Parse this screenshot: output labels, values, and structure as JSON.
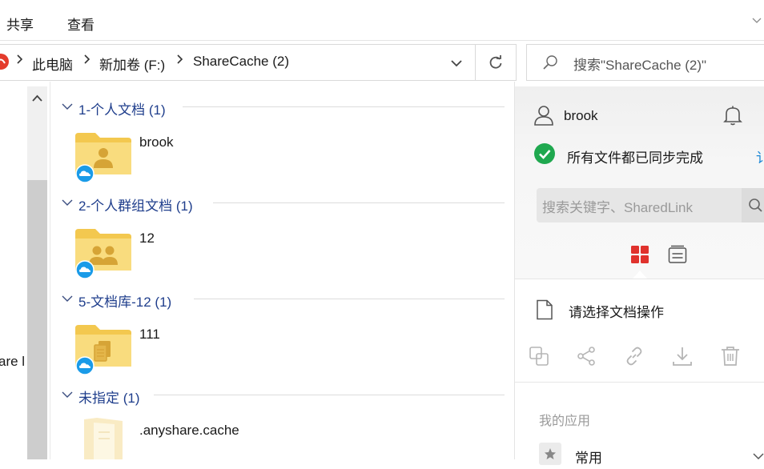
{
  "ribbon": {
    "tabs": [
      "共享",
      "查看"
    ]
  },
  "address": {
    "crumbs": [
      "此电脑",
      "新加卷 (F:)",
      "ShareCache (2)"
    ]
  },
  "search": {
    "placeholder": "搜索\"ShareCache (2)\""
  },
  "nav": {
    "partial_label": "are l"
  },
  "groups": [
    {
      "header": "1-个人文档 (1)",
      "item": "brook",
      "icon": "folder-user-icon"
    },
    {
      "header": "2-个人群组文档 (1)",
      "item": "12",
      "icon": "folder-group-icon"
    },
    {
      "header": "5-文档库-12 (1)",
      "item": "111",
      "icon": "folder-library-icon"
    },
    {
      "header": "未指定 (1)",
      "item": ".anyshare.cache",
      "icon": "folder-hidden-icon"
    }
  ],
  "panel": {
    "user": "brook",
    "sync_status": "所有文件都已同步完成",
    "sync_link_partial": "讠",
    "search_placeholder": "搜索关键字、SharedLink",
    "doc_prompt": "请选择文档操作",
    "apps_heading": "我的应用",
    "apps_first": "常用"
  },
  "colors": {
    "group_header": "#1f3e8c",
    "folder": "#f7d46b",
    "cloud_badge": "#1a9be8",
    "sync_ok": "#1fa84f",
    "grid_red": "#e0322d"
  }
}
